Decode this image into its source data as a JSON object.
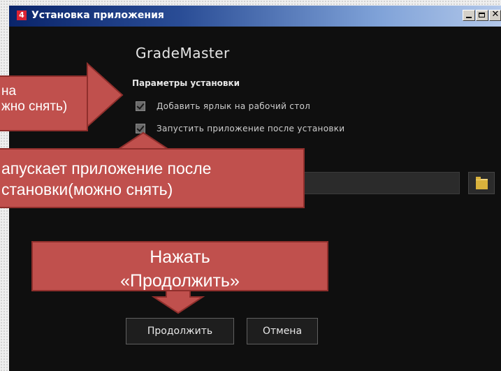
{
  "window": {
    "title": "Установка приложения",
    "icon": "installer-app-icon"
  },
  "installer": {
    "app_name": "GradeMaster",
    "section_title": "Параметры установки",
    "options": [
      {
        "label": "Добавить ярлык на рабочий стол",
        "checked": true
      },
      {
        "label": "Запустить приложение после установки",
        "checked": true
      }
    ],
    "continue_label": "Продолжить",
    "cancel_label": "Отмена"
  },
  "annotations": {
    "shortcut_callout_line1": "на",
    "shortcut_callout_line2": "жно снять)",
    "launch_callout_line1": "апускает приложение после",
    "launch_callout_line2": "становки(можно снять)",
    "continue_callout_line1": "Нажать",
    "continue_callout_line2": "«Продолжить»"
  },
  "colors": {
    "callout": "#c0504d",
    "window_bg": "#0f0f0f"
  }
}
